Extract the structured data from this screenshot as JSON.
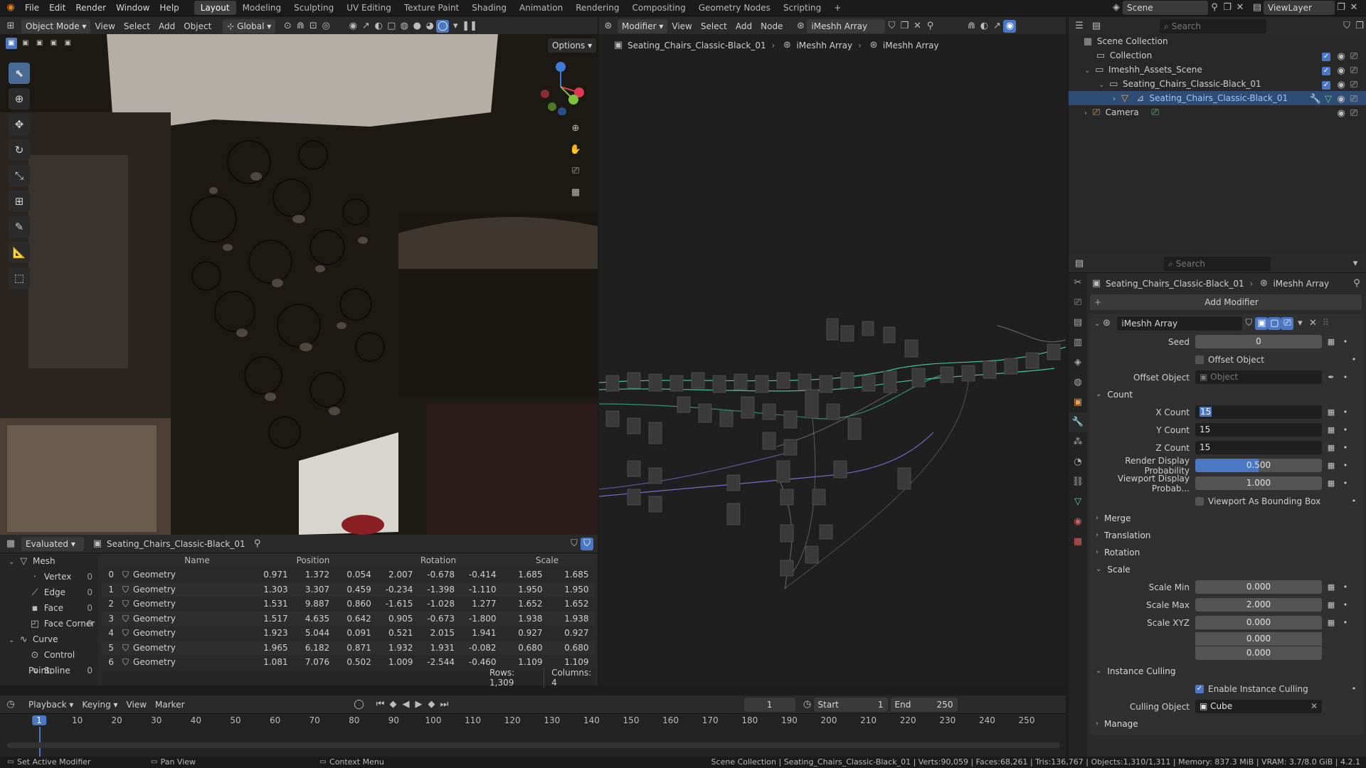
{
  "topbar": {
    "menus": [
      "File",
      "Edit",
      "Render",
      "Window",
      "Help"
    ],
    "workspaces": [
      "Layout",
      "Modeling",
      "Sculpting",
      "UV Editing",
      "Texture Paint",
      "Shading",
      "Animation",
      "Rendering",
      "Compositing",
      "Geometry Nodes",
      "Scripting"
    ],
    "active_workspace": "Layout",
    "scene_name": "Scene",
    "view_layer": "ViewLayer"
  },
  "viewport_header": {
    "mode": "Object Mode",
    "menus": [
      "View",
      "Select",
      "Add",
      "Object"
    ],
    "transform_orientation": "Global",
    "options_label": "Options"
  },
  "node_editor": {
    "editor_type": "Modifier",
    "menus": [
      "View",
      "Select",
      "Add",
      "Node"
    ],
    "node_group": "iMeshh Array",
    "breadcrumb": [
      "Seating_Chairs_Classic-Black_01",
      "iMeshh Array",
      "iMeshh Array"
    ]
  },
  "outliner": {
    "search_placeholder": "Search",
    "items": [
      {
        "label": "Scene Collection",
        "indent": 0
      },
      {
        "label": "Collection",
        "indent": 1
      },
      {
        "label": "Imeshh_Assets_Scene",
        "indent": 1
      },
      {
        "label": "Seating_Chairs_Classic-Black_01",
        "indent": 2
      },
      {
        "label": "Seating_Chairs_Classic-Black_01",
        "indent": 3,
        "selected": true
      },
      {
        "label": "Camera",
        "indent": 1
      }
    ]
  },
  "properties": {
    "search_placeholder": "Search",
    "breadcrumb_object": "Seating_Chairs_Classic-Black_01",
    "breadcrumb_modifier": "iMeshh Array",
    "add_modifier_label": "Add Modifier",
    "modifier_name": "iMeshh Array",
    "seed_label": "Seed",
    "seed_value": "0",
    "offset_object_toggle": "Offset Object",
    "offset_object_label": "Offset Object",
    "offset_object_placeholder": "Object",
    "count_panel": "Count",
    "x_count_label": "X Count",
    "x_count_value": "15",
    "y_count_label": "Y Count",
    "y_count_value": "15",
    "z_count_label": "Z Count",
    "z_count_value": "15",
    "render_prob_label": "Render Display Probability",
    "render_prob_value": "0.500",
    "render_prob_fraction": 0.5,
    "viewport_prob_label": "Viewport Display Probab...",
    "viewport_prob_value": "1.000",
    "viewport_bbox_label": "Viewport As Bounding Box",
    "merge_panel": "Merge",
    "translation_panel": "Translation",
    "rotation_panel": "Rotation",
    "scale_panel": "Scale",
    "scale_min_label": "Scale Min",
    "scale_min_value": "0.000",
    "scale_max_label": "Scale Max",
    "scale_max_value": "2.000",
    "scale_xyz_label": "Scale XYZ",
    "scale_xyz_values": [
      "0.000",
      "0.000",
      "0.000"
    ],
    "culling_panel": "Instance Culling",
    "enable_culling_label": "Enable Instance Culling",
    "culling_object_label": "Culling Object",
    "culling_object_value": "Cube",
    "manage_panel": "Manage"
  },
  "spreadsheet": {
    "mode": "Evaluated",
    "object": "Seating_Chairs_Classic-Black_01",
    "tree": [
      {
        "label": "Mesh",
        "count": "",
        "indent": 0
      },
      {
        "label": "Vertex",
        "count": "0",
        "indent": 1
      },
      {
        "label": "Edge",
        "count": "0",
        "indent": 1
      },
      {
        "label": "Face",
        "count": "0",
        "indent": 1
      },
      {
        "label": "Face Corner",
        "count": "0",
        "indent": 1
      },
      {
        "label": "Curve",
        "count": "",
        "indent": 0
      },
      {
        "label": "Control Point",
        "count": "0",
        "indent": 1
      },
      {
        "label": "Spline",
        "count": "0",
        "indent": 1
      }
    ],
    "columns": [
      "Name",
      "Position",
      "Rotation",
      "Scale"
    ],
    "rows": [
      {
        "idx": "0",
        "name": "Geometry",
        "pos": [
          "0.971",
          "1.372",
          "0.054"
        ],
        "rot": [
          "2.007",
          "-0.678",
          "-0.414"
        ],
        "scale": [
          "1.685",
          "1.685"
        ]
      },
      {
        "idx": "1",
        "name": "Geometry",
        "pos": [
          "1.303",
          "3.307",
          "0.459"
        ],
        "rot": [
          "-0.234",
          "-1.398",
          "-1.110"
        ],
        "scale": [
          "1.950",
          "1.950"
        ]
      },
      {
        "idx": "2",
        "name": "Geometry",
        "pos": [
          "1.531",
          "9.887",
          "0.860"
        ],
        "rot": [
          "-1.615",
          "-1.028",
          "1.277"
        ],
        "scale": [
          "1.652",
          "1.652"
        ]
      },
      {
        "idx": "3",
        "name": "Geometry",
        "pos": [
          "1.517",
          "4.635",
          "0.642"
        ],
        "rot": [
          "0.905",
          "-0.673",
          "-1.800"
        ],
        "scale": [
          "1.938",
          "1.938"
        ]
      },
      {
        "idx": "4",
        "name": "Geometry",
        "pos": [
          "1.923",
          "5.044",
          "0.091"
        ],
        "rot": [
          "0.521",
          "2.015",
          "1.941"
        ],
        "scale": [
          "0.927",
          "0.927"
        ]
      },
      {
        "idx": "5",
        "name": "Geometry",
        "pos": [
          "1.965",
          "6.182",
          "0.871"
        ],
        "rot": [
          "1.932",
          "1.931",
          "-0.082"
        ],
        "scale": [
          "0.680",
          "0.680"
        ]
      },
      {
        "idx": "6",
        "name": "Geometry",
        "pos": [
          "1.081",
          "7.076",
          "0.502"
        ],
        "rot": [
          "1.009",
          "-2.544",
          "-0.460"
        ],
        "scale": [
          "1.109",
          "1.109"
        ]
      }
    ],
    "rows_info": "Rows: 1,309",
    "columns_info": "Columns: 4"
  },
  "timeline": {
    "menus": [
      "Playback",
      "Keying",
      "View",
      "Marker"
    ],
    "current_frame": "1",
    "start_label": "Start",
    "start_value": "1",
    "end_label": "End",
    "end_value": "250",
    "ticks": [
      "1",
      "10",
      "20",
      "30",
      "40",
      "50",
      "60",
      "70",
      "80",
      "90",
      "100",
      "110",
      "120",
      "130",
      "140",
      "150",
      "160",
      "170",
      "180",
      "190",
      "200",
      "210",
      "220",
      "230",
      "240",
      "250"
    ]
  },
  "statusbar": {
    "left": [
      "Set Active Modifier",
      "Pan View",
      "Context Menu"
    ],
    "right": "Scene Collection | Seating_Chairs_Classic-Black_01 | Verts:90,059 | Faces:68,261 | Tris:136,767 | Objects:1,310/1,311 | Memory: 837.3 MiB | VRAM: 3.7/8.0 GiB | 4.2.1"
  },
  "colors": {
    "accent": "#4a78c4",
    "selection": "#2f4d74",
    "node_link_green": "#3fc39a",
    "node_link_purple": "#7a6ad0"
  }
}
